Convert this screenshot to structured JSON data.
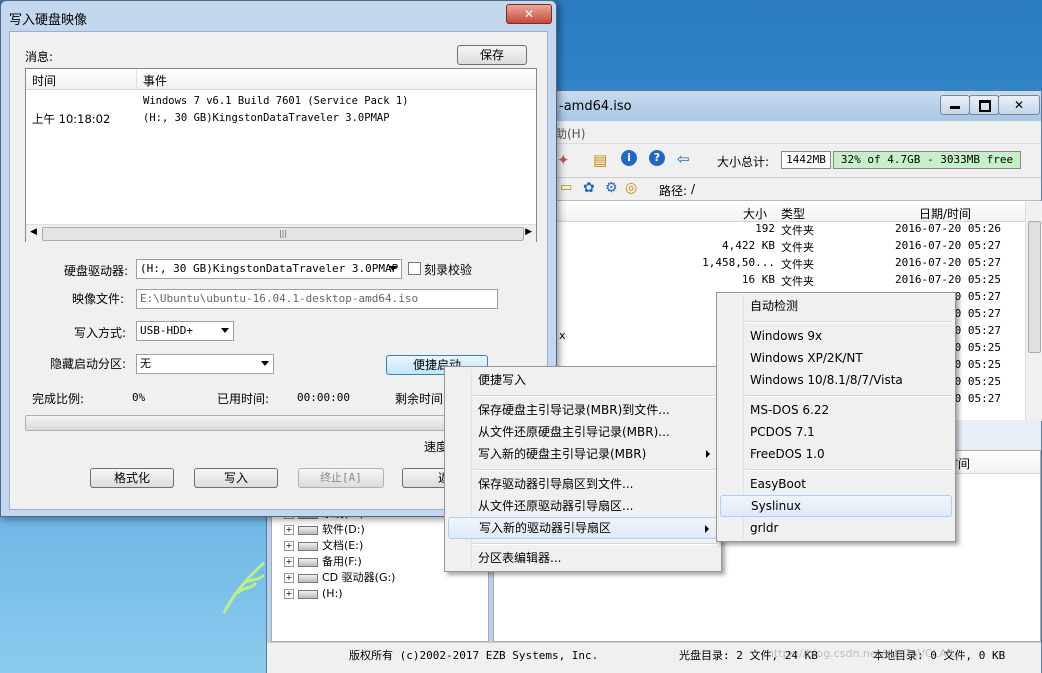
{
  "main_window": {
    "title_suffix": "-amd64.iso",
    "menu_help": "助(H)",
    "size_total_label": "大小总计:",
    "size_total_value": "1442MB",
    "capacity_text": "32% of 4.7GB - 3033MB free",
    "path_label": "路径:",
    "path_value": "/",
    "columns": {
      "size": "大小",
      "type": "类型",
      "date": "日期/时间"
    },
    "rows": [
      {
        "size": "192",
        "type": "文件夹",
        "date": "2016-07-20 05:26"
      },
      {
        "size": "4,422 KB",
        "type": "文件夹",
        "date": "2016-07-20 05:27"
      },
      {
        "size": "1,458,50...",
        "type": "文件夹",
        "date": "2016-07-20 05:27"
      },
      {
        "size": "16 KB",
        "type": "文件夹",
        "date": "2016-07-20 05:25"
      },
      {
        "date": "-07-20 05:27"
      },
      {
        "date": "-07-20 05:27"
      },
      {
        "date": "-07-20 05:27"
      },
      {
        "date": "-07-20 05:25"
      },
      {
        "date": "-07-20 05:25"
      },
      {
        "date": "-07-20 05:25"
      },
      {
        "date": "-07-20 05:27"
      }
    ],
    "partial_x": "x",
    "lower_date_header": "时间",
    "tree": [
      {
        "label": "系统(C:)"
      },
      {
        "label": "软件(D:)"
      },
      {
        "label": "文档(E:)"
      },
      {
        "label": "备用(F:)"
      },
      {
        "label": "CD 驱动器(G:)"
      },
      {
        "label": "(H:)"
      }
    ],
    "status": {
      "copyright": "版权所有 (c)2002-2017 EZB Systems, Inc.",
      "disc_dir": "光盘目录: 2 文件, 24 KB",
      "local_dir": "本地目录: 0 文件, 0 KB"
    }
  },
  "dialog": {
    "title": "写入硬盘映像",
    "messages_label": "消息:",
    "save_button": "保存",
    "log_columns": {
      "time": "时间",
      "event": "事件"
    },
    "log": {
      "line1": "Windows 7 v6.1 Build 7601 (Service Pack 1)",
      "time": "上午 10:18:02",
      "line2": "(H:, 30 GB)KingstonDataTraveler 3.0PMAP"
    },
    "drive_label": "硬盘驱动器:",
    "drive_value": "(H:, 30 GB)KingstonDataTraveler 3.0PMAP",
    "verify_label": "刻录校验",
    "image_label": "映像文件:",
    "image_value": "E:\\Ubuntu\\ubuntu-16.04.1-desktop-amd64.iso",
    "write_mode_label": "写入方式:",
    "write_mode_value": "USB-HDD+",
    "hidden_part_label": "隐藏启动分区:",
    "hidden_part_value": "无",
    "quick_boot_button": "便捷启动",
    "progress_label": "完成比例:",
    "progress_value": "0%",
    "elapsed_label": "已用时间:",
    "elapsed_value": "00:00:00",
    "remaining_label": "剩余时间",
    "speed_label": "速度",
    "progress_fraction": 0,
    "buttons": {
      "format": "格式化",
      "write": "写入",
      "stop": "终止[A]",
      "back": "返"
    }
  },
  "context_menu": {
    "items": [
      {
        "label": "便捷写入"
      },
      {
        "label": "保存硬盘主引导记录(MBR)到文件..."
      },
      {
        "label": "从文件还原硬盘主引导记录(MBR)..."
      },
      {
        "label": "写入新的硬盘主引导记录(MBR)"
      },
      {
        "label": "保存驱动器引导扇区到文件..."
      },
      {
        "label": "从文件还原驱动器引导扇区..."
      },
      {
        "label": "写入新的驱动器引导扇区"
      },
      {
        "label": "分区表编辑器..."
      }
    ]
  },
  "sub_menu": {
    "items": [
      {
        "label": "自动检测"
      },
      {
        "label": "Windows 9x"
      },
      {
        "label": "Windows XP/2K/NT"
      },
      {
        "label": "Windows 10/8.1/8/7/Vista"
      },
      {
        "label": "MS-DOS 6.22"
      },
      {
        "label": "PCDOS 7.1"
      },
      {
        "label": "FreeDOS 1.0"
      },
      {
        "label": "EasyBoot"
      },
      {
        "label": "Syslinux"
      },
      {
        "label": "grldr"
      }
    ]
  },
  "watermark": "https://blog.csdn.net/sdk7aVCLAfb",
  "colors": {
    "accent": "#3399ff",
    "capacity_fill": "#c8f0c8",
    "title_bar": "#a9c6e6"
  }
}
